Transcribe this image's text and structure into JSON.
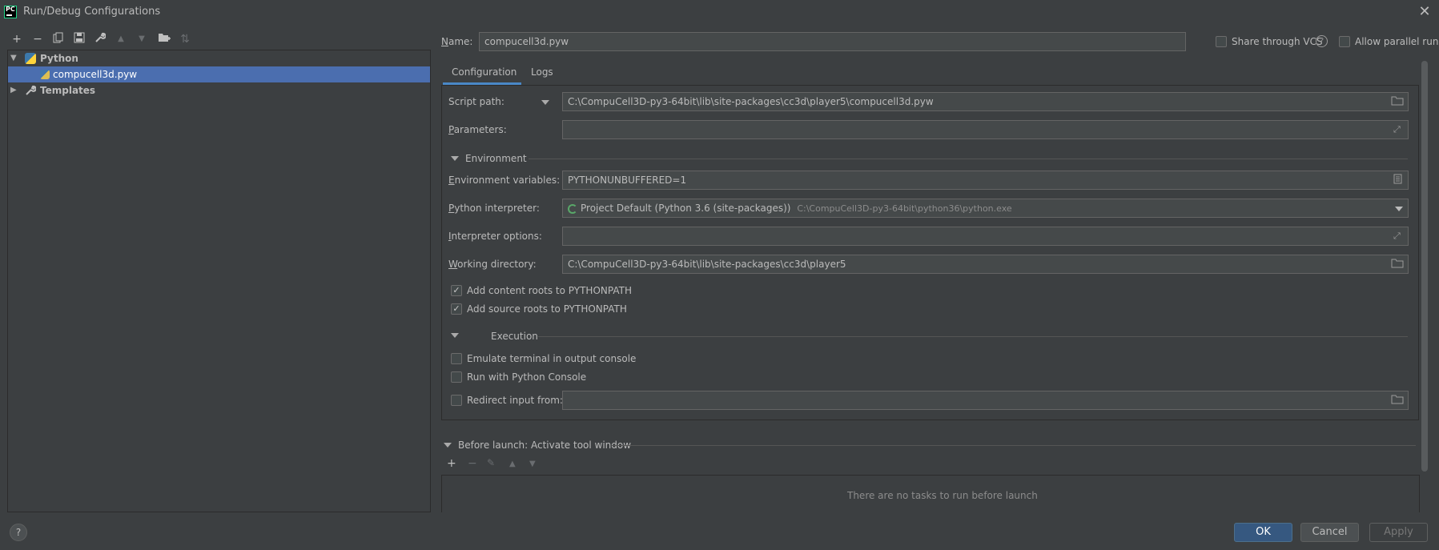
{
  "window": {
    "logo_text": "PC",
    "title": "Run/Debug Configurations",
    "close_glyph": "✕"
  },
  "toolbar": {
    "items": [
      {
        "name": "add-icon",
        "glyph": "+"
      },
      {
        "name": "remove-icon",
        "glyph": "−"
      },
      {
        "name": "copy-icon",
        "glyph": "⧉"
      },
      {
        "name": "save-icon",
        "glyph": "💾"
      },
      {
        "name": "wrench-icon",
        "glyph": "🔧"
      },
      {
        "name": "move-up-icon",
        "glyph": "▲"
      },
      {
        "name": "move-down-icon",
        "glyph": "▼"
      },
      {
        "name": "new-folder-icon",
        "glyph": "📁"
      },
      {
        "name": "sort-icon",
        "glyph": "⇅"
      }
    ]
  },
  "tree": {
    "python_label": "Python",
    "config_label": "compucell3d.pyw",
    "templates_label": "Templates"
  },
  "name_row": {
    "label": "Name:",
    "value": "compucell3d.pyw",
    "share_vcs_label": "Share through VCS",
    "allow_parallel_label": "Allow parallel run"
  },
  "tabs": {
    "configuration": "Configuration",
    "logs": "Logs"
  },
  "config": {
    "script_path_label": "Script path:",
    "script_path_value": "C:\\CompuCell3D-py3-64bit\\lib\\site-packages\\cc3d\\player5\\compucell3d.pyw",
    "parameters_label": "Parameters:",
    "parameters_value": "",
    "environment_section": "Environment",
    "env_vars_label": "Environment variables:",
    "env_vars_value": "PYTHONUNBUFFERED=1",
    "interpreter_label": "Python interpreter:",
    "interpreter_value": "Project Default (Python 3.6 (site-packages))",
    "interpreter_path": "C:\\CompuCell3D-py3-64bit\\python36\\python.exe",
    "interpreter_options_label": "Interpreter options:",
    "interpreter_options_value": "",
    "working_dir_label": "Working directory:",
    "working_dir_value": "C:\\CompuCell3D-py3-64bit\\lib\\site-packages\\cc3d\\player5",
    "add_content_roots_label": "Add content roots to PYTHONPATH",
    "add_content_roots_checked": true,
    "add_source_roots_label": "Add source roots to PYTHONPATH",
    "add_source_roots_checked": true,
    "execution_section": "Execution",
    "emulate_terminal_label": "Emulate terminal in output console",
    "run_with_console_label": "Run with Python Console",
    "redirect_input_label": "Redirect input from:",
    "redirect_input_value": ""
  },
  "before_launch": {
    "title": "Before launch: Activate tool window",
    "empty_text": "There are no tasks to run before launch"
  },
  "buttons": {
    "help": "?",
    "ok": "OK",
    "cancel": "Cancel",
    "apply": "Apply"
  },
  "colors": {
    "background": "#3c3f41",
    "selection": "#4b6eaf",
    "accent": "#4a88c7",
    "ok_button": "#365880"
  }
}
